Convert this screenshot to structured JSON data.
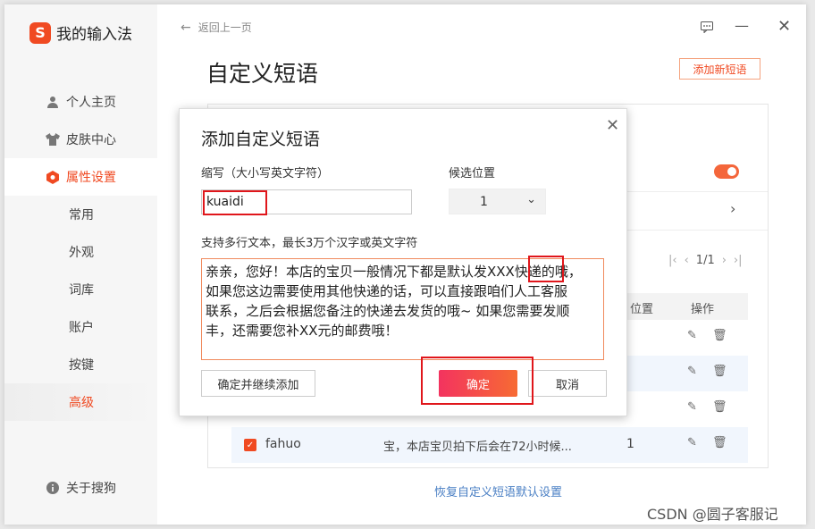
{
  "app": {
    "logo_glyph": "S",
    "title": "我的输入法"
  },
  "sidebar": {
    "items": [
      {
        "label": "个人主页",
        "icon": "person-icon"
      },
      {
        "label": "皮肤中心",
        "icon": "shirt-icon"
      },
      {
        "label": "属性设置",
        "icon": "hexagon-settings-icon",
        "active": true
      }
    ],
    "sub_items": [
      {
        "label": "常用"
      },
      {
        "label": "外观"
      },
      {
        "label": "词库"
      },
      {
        "label": "账户"
      },
      {
        "label": "按键"
      },
      {
        "label": "高级",
        "active": true
      }
    ],
    "about": {
      "label": "关于搜狗",
      "icon": "info-icon"
    }
  },
  "header": {
    "back_label": "返回上一页",
    "page_title": "自定义短语",
    "add_button": "添加新短语"
  },
  "list": {
    "pager": {
      "page": "1/1"
    },
    "columns": {
      "position": "位置",
      "actions": "操作"
    },
    "last_row": {
      "abbr": "fahuo",
      "content": "宝，本店宝贝拍下后会在72小时候...",
      "position": "1"
    },
    "restore_link": "恢复自定义短语默认设置"
  },
  "dialog": {
    "title": "添加自定义短语",
    "abbr_label": "缩写（大小写英文字符）",
    "abbr_value": "kuaidi",
    "position_label": "候选位置",
    "position_value": "1",
    "content_label": "支持多行文本，最长3万个汉字或英文字符",
    "content_value": "亲亲，您好！本店的宝贝一般情况下都是默认发XXX快递的哦，\n如果您这边需要使用其他快递的话，可以直接跟咱们人工客服\n联系，之后会根据您备注的快递去发货的哦~ 如果您需要发顺\n丰，还需要您补XX元的邮费哦！",
    "continue_button": "确定并继续添加",
    "ok_button": "确定",
    "cancel_button": "取消"
  },
  "watermark": "CSDN @圆子客服记",
  "colors": {
    "accent": "#f04a22",
    "highlight": "#e0161b",
    "link": "#4a7fc4"
  }
}
